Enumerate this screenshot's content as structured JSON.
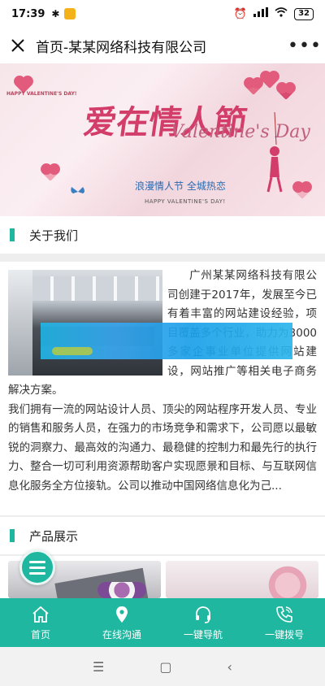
{
  "status_bar": {
    "time": "17:39",
    "battery": "32"
  },
  "title_bar": {
    "title": "首页-某某网络科技有限公司"
  },
  "banner": {
    "small_text": "HAPPY VALENTINE'S DAY!",
    "main_text": "爱在情人節",
    "script_text": "Valentine's Day",
    "subtitle": "浪漫情人节 全城热恋",
    "bottom_text": "HAPPY VALENTINE'S DAY!"
  },
  "about": {
    "header": "关于我们",
    "paragraph1": "广州某某网络科技有限公司创建于2017年，发展至今已有着丰富的网站建设经验，项目覆盖多个行业，助力为3000多家企事业单位提供网站建设，网站推广等相关电子商务解决方案。",
    "paragraph2": "我们拥有一流的网站设计人员、顶尖的网站程序开发人员、专业的销售和服务人员，在强力的市场竞争和需求下，公司愿以最敏锐的洞察力、最高效的沟通力、最稳健的控制力和最先行的执行力、整合一切可利用资源帮助客户实现愿景和目标、与互联网信息化服务全方位接轨。公司以推动中国网络信息化为己..."
  },
  "products": {
    "header": "产品展示"
  },
  "bottom_nav": {
    "items": [
      {
        "label": "首页"
      },
      {
        "label": "在线沟通"
      },
      {
        "label": "一键导航"
      },
      {
        "label": "一键拨号"
      }
    ]
  },
  "colors": {
    "accent": "#1fb7a0"
  }
}
